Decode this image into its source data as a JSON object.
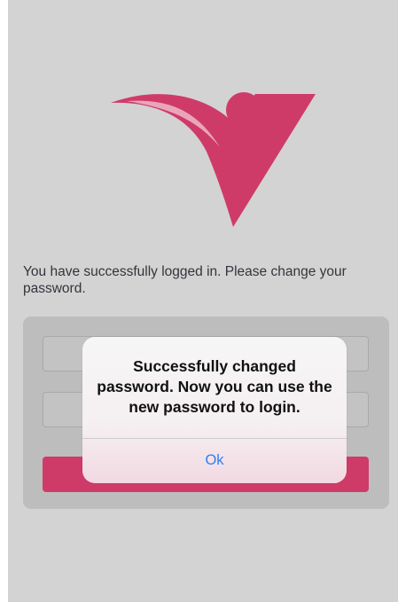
{
  "screen": {
    "background": "#d3d3d3",
    "brand_color": "#cf3b69"
  },
  "logo": {
    "icon": "brand-v-logo-icon"
  },
  "message": {
    "text": "You have successfully logged in. Please change your password."
  },
  "form": {
    "new_password_value": "",
    "confirm_password_value": "",
    "submit_label": ""
  },
  "alert": {
    "title": "Successfully changed password. Now you can use the new password to login.",
    "ok_label": "Ok",
    "ok_color": "#2f7ef6"
  }
}
